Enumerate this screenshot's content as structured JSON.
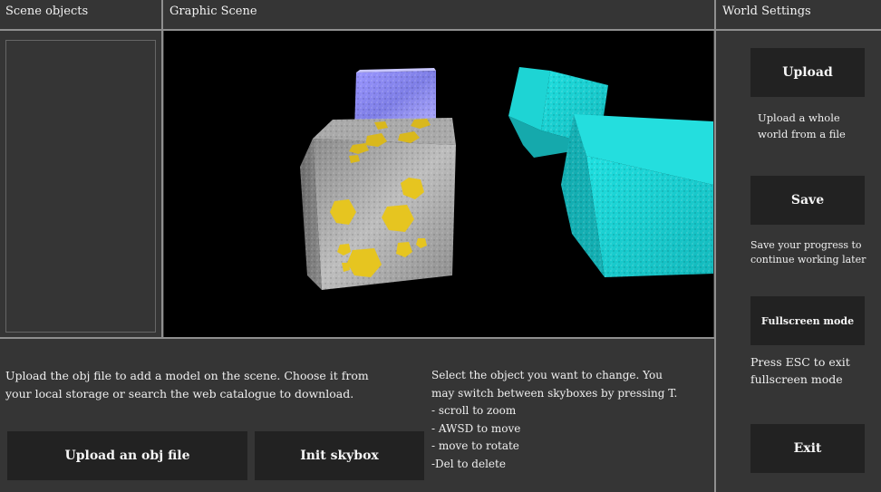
{
  "left_panel": {
    "header": "Scene objects"
  },
  "scene": {
    "header": "Graphic Scene"
  },
  "right_panel": {
    "header": "World Settings",
    "upload_label": "Upload",
    "upload_desc": [
      "Upload a whole",
      "world from a file"
    ],
    "save_label": "Save",
    "save_desc": [
      "Save your progress to",
      "continue working later"
    ],
    "fullscreen_label": "Fullscreen mode",
    "fullscreen_desc": [
      "Press ESC to exit",
      "fullscreen mode"
    ],
    "exit_label": "Exit"
  },
  "bottom": {
    "upload_text": [
      "Upload the obj file to add a model on the scene. Choose it from",
      "your local storage or search the web catalogue to download."
    ],
    "upload_obj_label": "Upload an obj file",
    "init_skybox_label": "Init skybox",
    "instructions": [
      "Select the object you want to change. You",
      "may switch between skyboxes by pressing T.",
      "- scroll to zoom",
      "- AWSD to move",
      "- move to rotate",
      "-Del to delete"
    ]
  },
  "colors": {
    "background": "#353535",
    "divider": "#8f8f8f",
    "button": "#222222",
    "viewport": "#000000",
    "cube_gold": "#e0c020",
    "cube_cyan": "#19d4d4",
    "cube_purple": "#8a86f0"
  }
}
